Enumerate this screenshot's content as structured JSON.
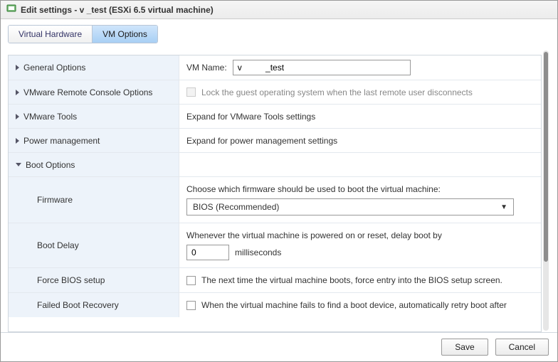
{
  "title": "Edit settings - v          _test (ESXi 6.5 virtual machine)",
  "tabs": {
    "hardware": "Virtual Hardware",
    "options": "VM Options"
  },
  "rows": {
    "general": {
      "label": "General Options"
    },
    "vmname": {
      "label": "VM Name:",
      "value": "v          _test"
    },
    "remote_console": {
      "label": "VMware Remote Console Options",
      "desc": "Lock the guest operating system when the last remote user disconnects"
    },
    "vmware_tools": {
      "label": "VMware Tools",
      "desc": "Expand for VMware Tools settings"
    },
    "power_mgmt": {
      "label": "Power management",
      "desc": "Expand for power management settings"
    },
    "boot_options": {
      "label": "Boot Options"
    },
    "firmware": {
      "label": "Firmware",
      "desc": "Choose which firmware should be used to boot the virtual machine:",
      "selected": "BIOS (Recommended)"
    },
    "boot_delay": {
      "label": "Boot Delay",
      "desc": "Whenever the virtual machine is powered on or reset, delay boot by",
      "value": "0",
      "unit": "milliseconds"
    },
    "force_bios": {
      "label": "Force BIOS setup",
      "desc": "The next time the virtual machine boots, force entry into the BIOS setup screen."
    },
    "failed_boot": {
      "label": "Failed Boot Recovery",
      "desc": "When the virtual machine fails to find a boot device, automatically retry boot after"
    }
  },
  "footer": {
    "save": "Save",
    "cancel": "Cancel"
  }
}
